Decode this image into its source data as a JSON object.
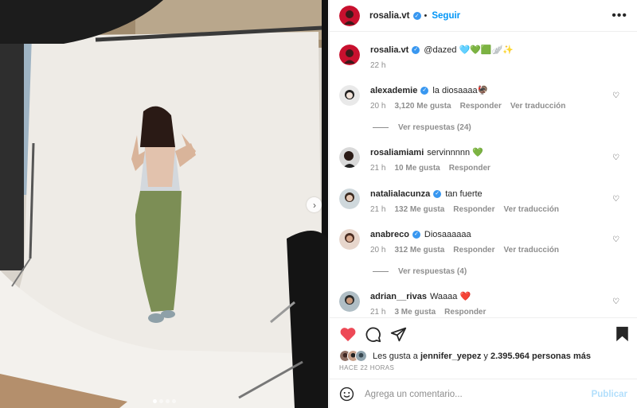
{
  "post": {
    "author": "rosalia.vt",
    "follow_label": "Seguir",
    "more_label": "•••",
    "caption_author": "rosalia.vt",
    "caption_text": "@dazed 🩵💚🟩🪽✨",
    "caption_time": "22 h"
  },
  "comments": [
    {
      "user": "alexademie",
      "text": "la diosaaaa🦃",
      "time": "20 h",
      "likes": "3,120 Me gusta",
      "reply": "Responder",
      "translate": "Ver traducción",
      "replies": "Ver respuestas (24)"
    },
    {
      "user": "rosaliamiami",
      "text": "servinnnnn 💚",
      "time": "21 h",
      "likes": "10 Me gusta",
      "reply": "Responder"
    },
    {
      "user": "natalialacunza",
      "text": "tan fuerte",
      "time": "21 h",
      "likes": "132 Me gusta",
      "reply": "Responder",
      "translate": "Ver traducción"
    },
    {
      "user": "anabreco",
      "text": "Diosaaaaaa",
      "time": "20 h",
      "likes": "312 Me gusta",
      "reply": "Responder",
      "translate": "Ver traducción",
      "replies": "Ver respuestas (4)"
    },
    {
      "user": "adrian__rivas",
      "text": "Waaaa ❤️",
      "time": "21 h",
      "likes": "3 Me gusta",
      "reply": "Responder"
    }
  ],
  "likes": {
    "prefix": "Les gusta a",
    "user": "jennifer_yepez",
    "joiner": "y",
    "count": "2.395.964 personas más"
  },
  "time_ago": "HACE 22 HORAS",
  "add_comment": {
    "placeholder": "Agrega un comentario...",
    "post_label": "Publicar"
  },
  "colors": {
    "accent": "#0095f6",
    "like": "#ed4956",
    "verified": "#3897f0"
  },
  "icons": [
    "heart-filled-icon",
    "comment-icon",
    "share-icon",
    "bookmark-icon",
    "emoji-icon",
    "chevron-right-icon"
  ]
}
